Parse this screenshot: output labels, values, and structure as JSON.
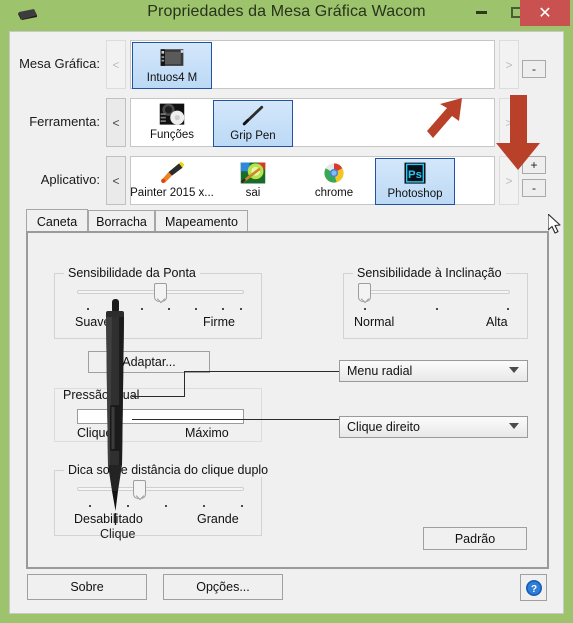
{
  "window": {
    "title": "Propriedades da Mesa Gráfica Wacom",
    "icon": "tablet-icon",
    "minimize_label": "–",
    "maximize_label": "□",
    "close_label": "✕",
    "titlebar_color": "#9dc46c",
    "close_button_color": "#c9514f",
    "selection_color": "#2353a0"
  },
  "selectors": [
    {
      "label": "Mesa Gráfica:",
      "prev_label": "<",
      "next_label": ">",
      "prev_disabled": true,
      "next_disabled": true,
      "items": [
        {
          "label": "Intuos4 M",
          "icon": "tablet-icon",
          "selected": true
        }
      ],
      "side_button": {
        "label": "-",
        "name": "remove-tablet-button"
      }
    },
    {
      "label": "Ferramenta:",
      "prev_label": "<",
      "next_label": ">",
      "prev_disabled": false,
      "next_disabled": true,
      "items": [
        {
          "label": "Funções",
          "icon": "tablet-functions-icon",
          "selected": false
        },
        {
          "label": "Grip Pen",
          "icon": "pen-icon",
          "selected": true
        }
      ],
      "side_button": null
    },
    {
      "label": "Aplicativo:",
      "prev_label": "<",
      "next_label": ">",
      "prev_disabled": false,
      "next_disabled": true,
      "items": [
        {
          "label": "Painter 2015 x...",
          "icon": "painter-icon",
          "selected": false
        },
        {
          "label": "sai",
          "icon": "sai-icon",
          "selected": false
        },
        {
          "label": "chrome",
          "icon": "chrome-icon",
          "selected": false
        },
        {
          "label": "Photoshop",
          "icon": "photoshop-icon",
          "selected": true
        }
      ],
      "add_button": {
        "label": "+",
        "name": "add-application-button"
      },
      "remove_button": {
        "label": "-",
        "name": "remove-application-button"
      }
    }
  ],
  "tabs": [
    {
      "label": "Caneta",
      "active": true
    },
    {
      "label": "Borracha",
      "active": false
    },
    {
      "label": "Mapeamento",
      "active": false
    }
  ],
  "panel": {
    "tip_feel": {
      "title": "Sensibilidade da Ponta",
      "min_label": "Suave",
      "max_label": "Firme",
      "ticks": 7,
      "value": 4,
      "customize_button": "Adaptar..."
    },
    "current_pressure": {
      "title": "Pressão atual",
      "min_label": "Clique",
      "max_label": "Máximo",
      "value": 0
    },
    "double_click_distance": {
      "title": "Dica sobre distância do clique duplo",
      "min_label": "Desabilitado",
      "max_label": "Grande",
      "ticks": 5,
      "value": 3
    },
    "tilt_sensitivity": {
      "title": "Sensibilidade à Inclinação",
      "min_label": "Normal",
      "max_label": "Alta",
      "ticks": 3,
      "value": 1
    },
    "pen_buttons": [
      {
        "value": "Menu radial",
        "name": "upper-pen-button-select"
      },
      {
        "value": "Clique direito",
        "name": "lower-pen-button-select"
      }
    ],
    "pen_tip_caption": "Clique",
    "default_button": "Padrão"
  },
  "footer": {
    "about_button": "Sobre",
    "options_button": "Opções...",
    "help_icon": "help-icon"
  },
  "annotations": {
    "arrow_color": "#b9412a",
    "arrows": [
      {
        "name": "arrow-pointing-photoshop"
      },
      {
        "name": "arrow-pointing-add-button"
      }
    ]
  }
}
